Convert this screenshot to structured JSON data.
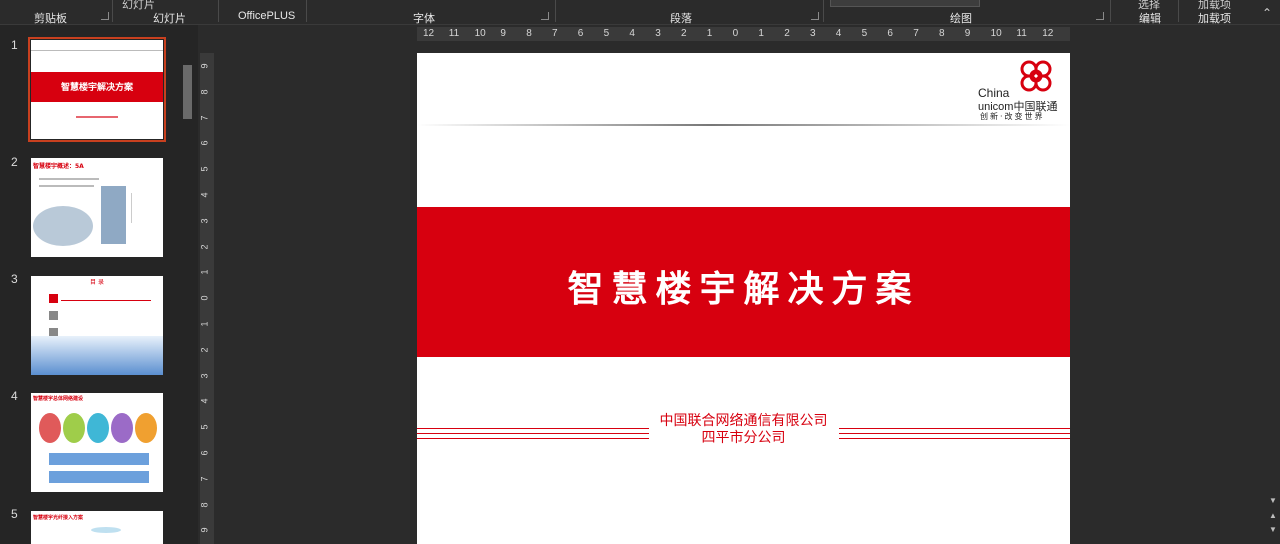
{
  "ribbon": {
    "groups": [
      {
        "label": "剪贴板"
      },
      {
        "label": "幻灯片"
      },
      {
        "label": "OfficePLUS"
      },
      {
        "label": "字体"
      },
      {
        "label": "段落"
      },
      {
        "label": "绘图"
      },
      {
        "label": "编辑"
      },
      {
        "label": "加载项"
      }
    ],
    "top_fragments": [
      "幻灯片",
      "选择",
      "加载项"
    ]
  },
  "thumbnails": [
    {
      "number": "1",
      "title": "智慧楼宇解决方案",
      "selected": true
    },
    {
      "number": "2",
      "title": "智慧楼宇概述：5A",
      "selected": false
    },
    {
      "number": "3",
      "title": "目 录",
      "selected": false
    },
    {
      "number": "4",
      "title": "智慧楼宇总体网络建设",
      "selected": false
    },
    {
      "number": "5",
      "title": "智慧楼宇光纤接入方案",
      "selected": false
    }
  ],
  "hruler_ticks": [
    "12",
    "11",
    "10",
    "9",
    "8",
    "7",
    "6",
    "5",
    "4",
    "3",
    "2",
    "1",
    "0",
    "1",
    "2",
    "3",
    "4",
    "5",
    "6",
    "7",
    "8",
    "9",
    "10",
    "11",
    "12"
  ],
  "vruler_ticks": [
    "9",
    "8",
    "7",
    "6",
    "5",
    "4",
    "3",
    "2",
    "1",
    "0",
    "1",
    "2",
    "3",
    "4",
    "5",
    "6",
    "7",
    "8",
    "9"
  ],
  "slide": {
    "title": "智慧楼宇解决方案",
    "company_line1": "中国联合网络通信有限公司",
    "company_line2": "四平市分公司",
    "logo_china": "China",
    "logo_unicom": "unicom中国联通",
    "logo_slogan": "创新·改变世界"
  },
  "colors": {
    "brand_red": "#d7000f",
    "selection": "#c8401f"
  }
}
